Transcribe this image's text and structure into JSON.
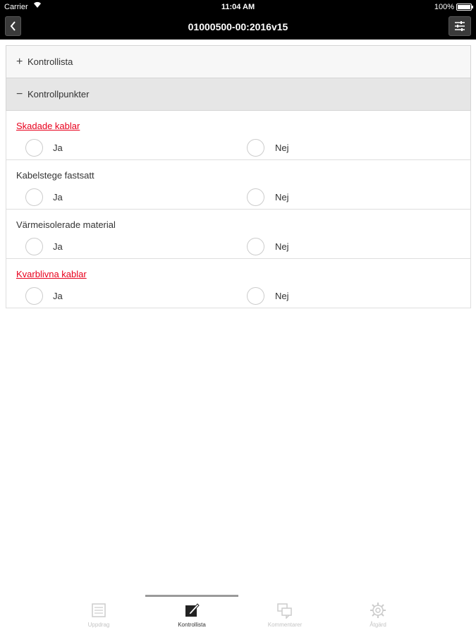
{
  "status_bar": {
    "carrier": "Carrier",
    "time": "11:04 AM",
    "battery": "100%"
  },
  "nav": {
    "title": "01000500-00:2016v15",
    "back_icon": "chevron-left-icon",
    "settings_icon": "sliders-icon"
  },
  "sections": {
    "kontrollista": {
      "sign": "+",
      "label": "Kontrollista"
    },
    "kontrollpunkter": {
      "sign": "−",
      "label": "Kontrollpunkter"
    }
  },
  "items": [
    {
      "label": "Skadade kablar",
      "flagged": true,
      "yes": "Ja",
      "no": "Nej"
    },
    {
      "label": "Kabelstege fastsatt",
      "flagged": false,
      "yes": "Ja",
      "no": "Nej"
    },
    {
      "label": "Värmeisolerade material",
      "flagged": false,
      "yes": "Ja",
      "no": "Nej"
    },
    {
      "label": "Kvarblivna kablar",
      "flagged": true,
      "yes": "Ja",
      "no": "Nej"
    }
  ],
  "tabs": [
    {
      "label": "Uppdrag",
      "icon": "list-icon",
      "active": false
    },
    {
      "label": "Kontrollista",
      "icon": "edit-checklist-icon",
      "active": true
    },
    {
      "label": "Kommentarer",
      "icon": "comments-icon",
      "active": false
    },
    {
      "label": "Åtgärd",
      "icon": "gear-icon",
      "active": false
    }
  ],
  "colors": {
    "flagged": "#e8001c",
    "bar": "#000000",
    "tab_active_indicator": "#9a9a9a"
  }
}
